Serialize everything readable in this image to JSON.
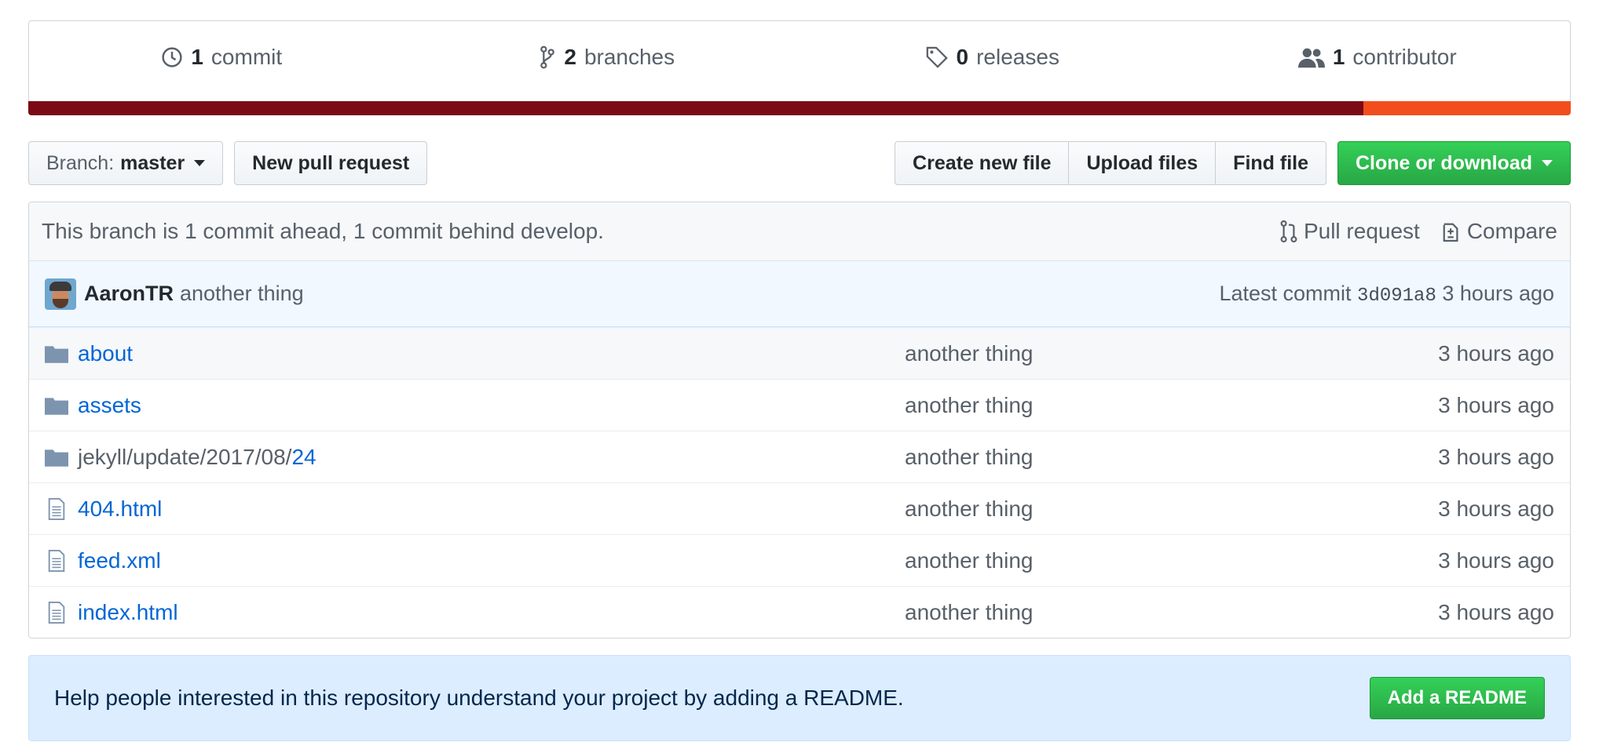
{
  "summary": {
    "commits": {
      "count": "1",
      "label": "commit"
    },
    "branches": {
      "count": "2",
      "label": "branches"
    },
    "releases": {
      "count": "0",
      "label": "releases"
    },
    "contributors": {
      "count": "1",
      "label": "contributor"
    }
  },
  "languages": {
    "colors": [
      "#7a0a16",
      "#f24e1d"
    ]
  },
  "toolbar": {
    "branch_prefix": "Branch:",
    "branch_name": "master",
    "new_pull_request": "New pull request",
    "create_new_file": "Create new file",
    "upload_files": "Upload files",
    "find_file": "Find file",
    "clone_or_download": "Clone or download"
  },
  "branch_info": {
    "text": "This branch is 1 commit ahead, 1 commit behind develop.",
    "pull_request": "Pull request",
    "compare": "Compare"
  },
  "latest_commit": {
    "author": "AaronTR",
    "message": "another thing",
    "prefix": "Latest commit",
    "sha": "3d091a8",
    "age": "3 hours ago"
  },
  "files": [
    {
      "type": "folder",
      "name": "about",
      "message": "another thing",
      "age": "3 hours ago"
    },
    {
      "type": "folder",
      "name": "assets",
      "message": "another thing",
      "age": "3 hours ago"
    },
    {
      "type": "folder",
      "name_prefix": "jekyll/update/2017/08/",
      "name": "24",
      "message": "another thing",
      "age": "3 hours ago"
    },
    {
      "type": "file",
      "name": "404.html",
      "message": "another thing",
      "age": "3 hours ago"
    },
    {
      "type": "file",
      "name": "feed.xml",
      "message": "another thing",
      "age": "3 hours ago"
    },
    {
      "type": "file",
      "name": "index.html",
      "message": "another thing",
      "age": "3 hours ago"
    }
  ],
  "readme": {
    "text": "Help people interested in this repository understand your project by adding a README.",
    "button": "Add a README"
  }
}
